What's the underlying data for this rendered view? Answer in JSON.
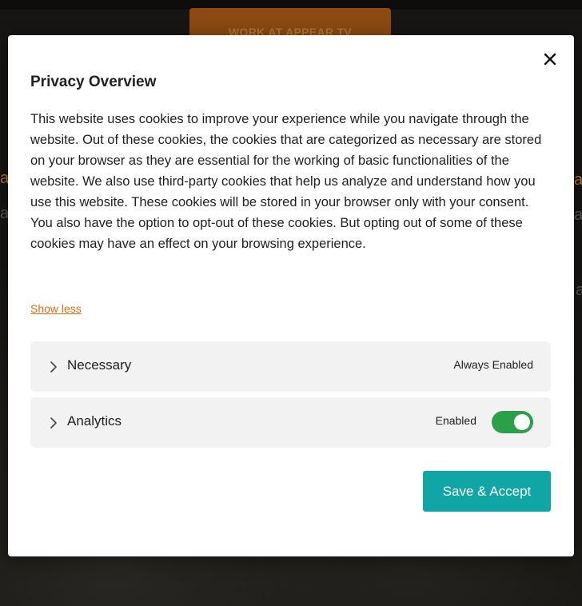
{
  "background": {
    "cta_label": "WORK AT APPEAR TV",
    "side_glyph_a": "a",
    "side_glyph_b": "a"
  },
  "modal": {
    "title": "Privacy Overview",
    "body": "This website uses cookies to improve your experience while you navigate through the website. Out of these cookies, the cookies that are categorized as necessary are stored on your browser as they are essential for the working of basic functionalities of the website. We also use third-party cookies that help us analyze and understand how you use this website. These cookies will be stored in your browser only with your consent. You also have the option to opt-out of these cookies. But opting out of some of these cookies may have an effect on your browsing experience.",
    "show_less_label": "Show less",
    "categories": [
      {
        "label": "Necessary",
        "status": "Always Enabled",
        "icon": "chevron-right-icon"
      },
      {
        "label": "Analytics",
        "status": "Enabled",
        "toggle_on": true,
        "icon": "chevron-right-icon"
      }
    ],
    "save_label": "Save & Accept",
    "close_icon": "close-icon"
  },
  "colors": {
    "accent_link": "#e36a11",
    "toggle_on": "#2aa04a",
    "primary_button": "#11a6a6",
    "row_background": "#f2f2f2"
  }
}
